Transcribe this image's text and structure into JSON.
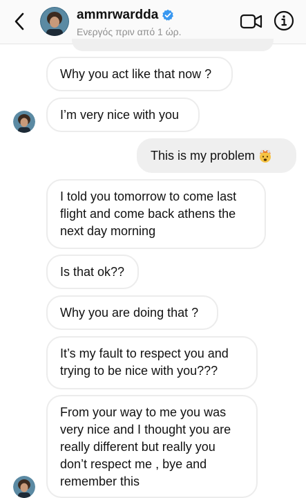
{
  "header": {
    "username": "ammrwardda",
    "status": "Ενεργός πριν από 1 ώρ.",
    "back_icon": "chevron-left-icon",
    "verified_icon": "verified-badge-icon",
    "video_icon": "video-camera-icon",
    "info_icon": "info-icon"
  },
  "messages": [
    {
      "from": "them",
      "text": "Why you act like that now ?"
    },
    {
      "from": "them",
      "text": "I’m very nice with you"
    },
    {
      "from": "me",
      "text": "This is my problem",
      "emoji": "exploding-head-emoji"
    },
    {
      "from": "them",
      "lines": [
        "I told you tomorrow to come last",
        "flight and come back athens the",
        "next day morning"
      ]
    },
    {
      "from": "them",
      "text": "Is that ok??"
    },
    {
      "from": "them",
      "text": "Why you are doing that ?"
    },
    {
      "from": "them",
      "lines": [
        "It’s my fault to respect you and",
        "trying to be nice with you???"
      ]
    },
    {
      "from": "them",
      "lines": [
        "From your way to me you was",
        "very nice and I thought you are",
        "really different but really you",
        "don’t respect me , bye and",
        "remember this"
      ]
    }
  ],
  "colors": {
    "verified": "#3897f0",
    "bubble_border": "#ececec",
    "my_bubble": "#efefef",
    "muted_text": "#8e8e8e"
  }
}
